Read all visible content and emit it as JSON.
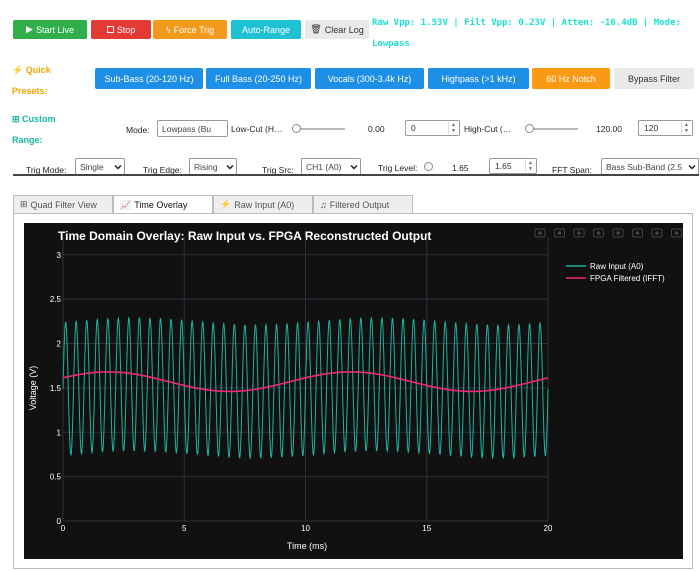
{
  "toolbar": {
    "start_label": "Start Live",
    "stop_label": "Stop",
    "force_trig_label": "Force Trig",
    "auto_range_label": "Auto-Range",
    "clear_log_label": "Clear Log",
    "colors": {
      "start": "#2fae4a",
      "stop": "#e53935",
      "force": "#f39a1c",
      "auto": "#1fc0d4",
      "clear": "#e9e9e9"
    }
  },
  "status": {
    "text": "Raw Vpp: 1.53V | Filt Vpp: 0.23V | Atten: -16.4dB | Mode: Lowpass",
    "color": "#19e3d0"
  },
  "quick_presets": {
    "heading": "⚡ Quick Presets:",
    "items": [
      {
        "label": "Sub-Bass (20-120 Hz)",
        "color": "#1e8fe6"
      },
      {
        "label": "Full Bass (20-250 Hz)",
        "color": "#1e8fe6"
      },
      {
        "label": "Vocals (300-3.4k Hz)",
        "color": "#1e8fe6"
      },
      {
        "label": "Highpass (>1 kHz)",
        "color": "#1e8fe6"
      },
      {
        "label": "60 Hz Notch",
        "color": "#fa9a14"
      },
      {
        "label": "Bypass Filter",
        "color": "#e9e9e9"
      }
    ]
  },
  "custom_range": {
    "heading": "⊞ Custom Range:",
    "mode_label": "Mode:",
    "mode_value": "Lowpass (Bu",
    "lowcut_label": "Low-Cut (H…",
    "lowcut_value": "0.00",
    "lowcut_input": "0",
    "lowcut_fraction": 0,
    "highcut_label": "High-Cut (…",
    "highcut_value": "120.00",
    "highcut_input": "120",
    "highcut_fraction": 0
  },
  "trigger": {
    "mode_label": "Trig Mode:",
    "mode_value": "Single",
    "edge_label": "Trig Edge:",
    "edge_value": "Rising",
    "src_label": "Trig Src:",
    "src_value": "CH1 (A0)",
    "level_label": "Trig Level:",
    "level_value": "1.65",
    "level_input": "1.65",
    "fft_label": "FFT Span:",
    "fft_value": "Bass Sub-Band (2.5"
  },
  "tabs": [
    {
      "label": "Quad Filter View",
      "icon": "grid-icon"
    },
    {
      "label": "Time Overlay",
      "icon": "line-chart-icon"
    },
    {
      "label": "Raw Input (A0)",
      "icon": "plug-icon"
    },
    {
      "label": "Filtered Output",
      "icon": "music-note-icon"
    }
  ],
  "chart_data": {
    "type": "line",
    "title": "Time Domain Overlay: Raw Input vs. FPGA Reconstructed Output",
    "xlabel": "Time (ms)",
    "ylabel": "Voltage (V)",
    "xlim": [
      0,
      20
    ],
    "ylim": [
      0,
      3.2
    ],
    "xticks": [
      0,
      5,
      10,
      15,
      20
    ],
    "yticks": [
      0,
      0.5,
      1,
      1.5,
      2,
      2.5,
      3
    ],
    "grid": true,
    "legend": "top-right",
    "series": [
      {
        "name": "Raw Input (A0)",
        "color": "#1fb39f",
        "offset_v": 1.5,
        "amplitude_v": 0.75,
        "frequency_khz": 2.3
      },
      {
        "name": "FPGA Filtered (IFFT)",
        "color": "#f0287a",
        "offset_v": 1.57,
        "amplitude_v": 0.11,
        "frequency_khz": 0.1
      }
    ]
  },
  "plot_toolbar": [
    "camera-icon",
    "zoom-icon",
    "pan-icon",
    "zoom-in-icon",
    "zoom-out-icon",
    "autoscale-icon",
    "home-icon",
    "plotly-logo-icon"
  ]
}
